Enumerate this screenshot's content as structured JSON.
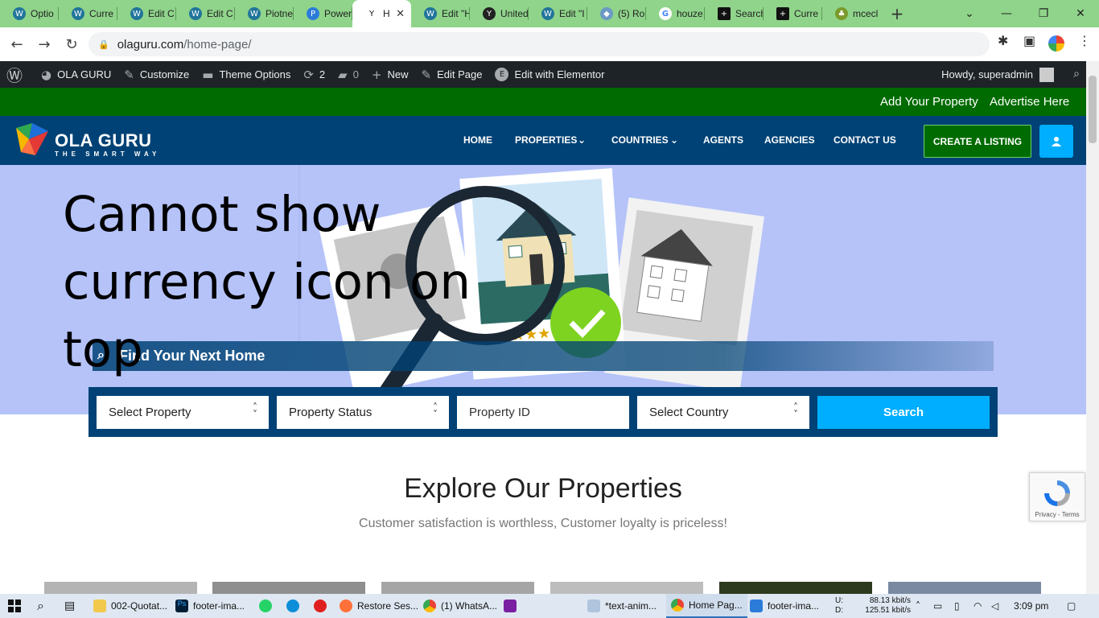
{
  "browser": {
    "tabs": [
      {
        "label": "Optio",
        "icon": "wordpress-icon"
      },
      {
        "label": "Curre",
        "icon": "wordpress-icon"
      },
      {
        "label": "Edit C",
        "icon": "wordpress-icon"
      },
      {
        "label": "Edit C",
        "icon": "wordpress-icon"
      },
      {
        "label": "Piotne",
        "icon": "wordpress-icon"
      },
      {
        "label": "Power",
        "icon": "power-icon"
      },
      {
        "label": "H",
        "icon": "houzez-icon",
        "active": true
      },
      {
        "label": "Edit \"H",
        "icon": "wordpress-icon"
      },
      {
        "label": "United",
        "icon": "houzez-icon"
      },
      {
        "label": "Edit \"I",
        "icon": "wordpress-icon"
      },
      {
        "label": "(5) Ro",
        "icon": "cube-icon"
      },
      {
        "label": "houze",
        "icon": "google-icon"
      },
      {
        "label": "Search",
        "icon": "plus-box-icon"
      },
      {
        "label": "Curre",
        "icon": "plus-box-icon"
      },
      {
        "label": "mcecl",
        "icon": "leaf-icon"
      }
    ],
    "url_host": "olaguru.com",
    "url_path": "/home-page/"
  },
  "wp_admin_bar": {
    "site_name": "OLA GURU",
    "customize": "Customize",
    "theme_options": "Theme Options",
    "updates_count": "2",
    "comments_count": "0",
    "new": "New",
    "edit_page": "Edit Page",
    "edit_elementor": "Edit with Elementor",
    "howdy": "Howdy, superadmin"
  },
  "top_links": {
    "add_property": "Add Your Property",
    "advertise": "Advertise Here"
  },
  "header": {
    "logo_name": "OLA GURU",
    "logo_tagline": "THE SMART WAY",
    "menu": {
      "home": "HOME",
      "properties": "PROPERTIES",
      "countries": "COUNTRIES",
      "agents": "AGENTS",
      "agencies": "AGENCIES",
      "contact": "CONTACT US"
    },
    "create_listing": "CREATE A LISTING"
  },
  "hero": {
    "overlay_text": "Cannot show currency icon on top",
    "find_home": "Find Your Next Home"
  },
  "search": {
    "select_property": "Select Property",
    "property_status": "Property Status",
    "property_id_placeholder": "Property ID",
    "select_country": "Select Country",
    "button": "Search"
  },
  "section": {
    "title": "Explore Our Properties",
    "subtitle": "Customer satisfaction is worthless, Customer loyalty is priceless!"
  },
  "recaptcha": {
    "privacy": "Privacy",
    "terms": "Terms"
  },
  "taskbar": {
    "items": [
      {
        "label": "002-Quotat..."
      },
      {
        "label": "footer-ima..."
      },
      {
        "label": "Restore Ses..."
      },
      {
        "label": "(1) WhatsA..."
      },
      {
        "label": "*text-anim..."
      },
      {
        "label": "Home Pag...",
        "active": true
      },
      {
        "label": "footer-ima..."
      }
    ],
    "net_up_label": "U:",
    "net_down_label": "D:",
    "net_up": "88.13 kbit/s",
    "net_down": "125.51 kbit/s",
    "time": "3:09 pm"
  }
}
